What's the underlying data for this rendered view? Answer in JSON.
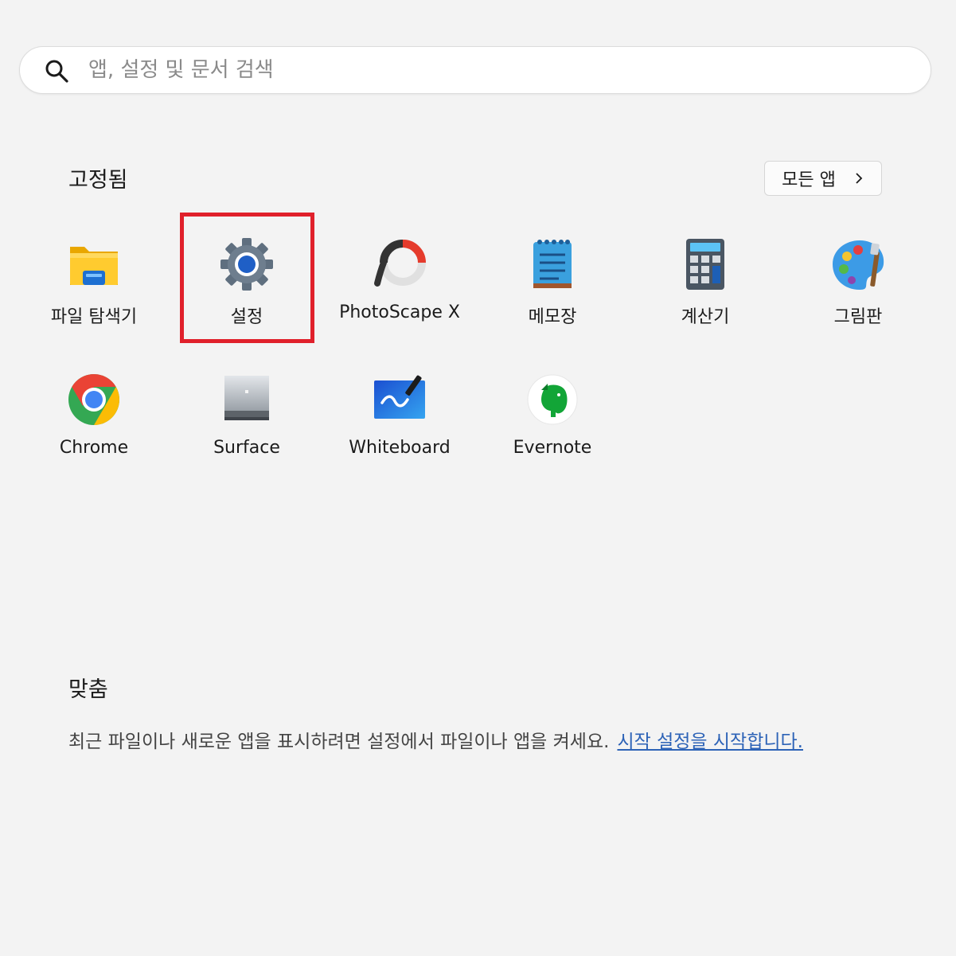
{
  "search": {
    "placeholder": "앱, 설정 및 문서 검색"
  },
  "pinned": {
    "title": "고정됨",
    "all_apps_label": "모든 앱",
    "apps": [
      {
        "label": "파일 탐색기",
        "icon": "file-explorer-icon"
      },
      {
        "label": "설정",
        "icon": "settings-gear-icon"
      },
      {
        "label": "PhotoScape X",
        "icon": "photoscape-icon"
      },
      {
        "label": "메모장",
        "icon": "notepad-icon"
      },
      {
        "label": "계산기",
        "icon": "calculator-icon"
      },
      {
        "label": "그림판",
        "icon": "paint-icon"
      },
      {
        "label": "Chrome",
        "icon": "chrome-icon"
      },
      {
        "label": "Surface",
        "icon": "surface-icon"
      },
      {
        "label": "Whiteboard",
        "icon": "whiteboard-icon"
      },
      {
        "label": "Evernote",
        "icon": "evernote-icon"
      }
    ]
  },
  "recommended": {
    "title": "맞춤",
    "message": "최근 파일이나 새로운 앱을 표시하려면 설정에서 파일이나 앱을 켜세요.",
    "link": "시작 설정을 시작합니다."
  },
  "colors": {
    "background": "#f3f3f3",
    "highlight": "#e0202b",
    "link": "#2d63b7"
  }
}
